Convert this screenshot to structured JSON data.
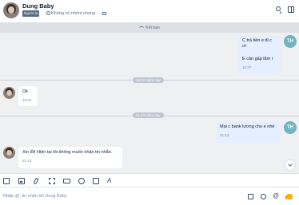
{
  "header": {
    "name": "Dung Baby",
    "tag": "Người lạ",
    "group_info": "Không có nhóm chung",
    "icons": [
      "note-icon",
      "search-icon",
      "layout-icon"
    ]
  },
  "friend_bar": {
    "label": "Kết bạn",
    "icon": "add-friend-icon"
  },
  "messages": [
    {
      "side": "me",
      "lines": [
        "C trả tiền e đi c ơi",
        "E cần gấp lắm r"
      ],
      "time": "12:37",
      "avatar_initials": "TH"
    },
    {
      "divider": "16:21 Hôm nay"
    },
    {
      "side": "them",
      "lines": [
        "Ok"
      ],
      "time": "18:21"
    },
    {
      "divider": "21:13 Hôm nay"
    },
    {
      "side": "me",
      "lines": [
        "Mai c bank lương cho e nhé"
      ],
      "time": "21:13",
      "avatar_initials": "TH"
    },
    {
      "side": "them",
      "lines": [
        "Xin lỗi! Hiện tại tôi không muốn nhận tin nhắn."
      ],
      "time": "21:13"
    }
  ],
  "composer": {
    "placeholder": "Nhập @, tin nhắn tới Dung Baby",
    "tools": [
      "sticker-icon",
      "image-icon",
      "attach-icon",
      "screenshot-icon",
      "card-icon",
      "reminder-icon",
      "task-icon",
      "format-icon"
    ],
    "right_icons": [
      "quick-message-icon",
      "emoji-icon",
      "mention-icon",
      "like-icon"
    ]
  },
  "colors": {
    "my_bubble": "#e5efff",
    "their_bubble": "#ffffff",
    "chat_bg": "#eef0f1",
    "avatar_th": "#70b4c2",
    "like": "#f5b400"
  }
}
